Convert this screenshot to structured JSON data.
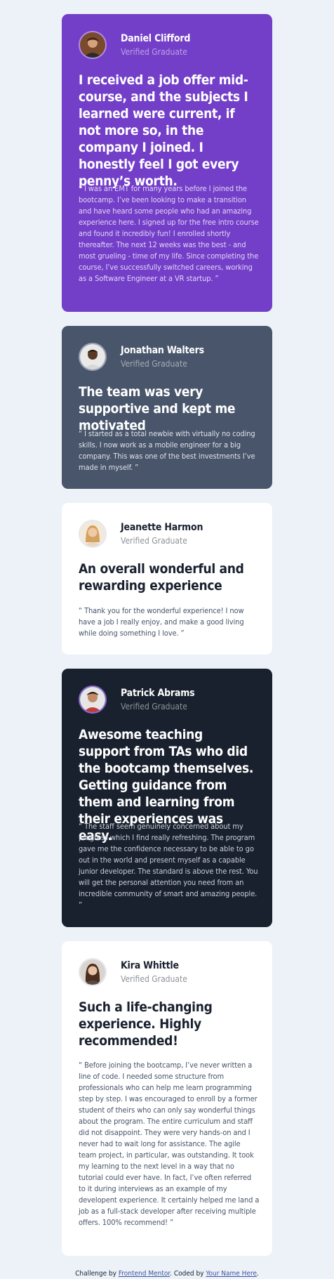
{
  "cards": [
    {
      "name": "Daniel Clifford",
      "role": "Verified Graduate",
      "headline": "I received a job offer mid-course, and the subjects I learned were current, if not more so, in the company I joined. I honestly feel I got every penny’s worth.",
      "quote": "“ I was an EMT for many years before I joined the bootcamp. I’ve been looking to make a transition and have heard some people who had an amazing experience here. I signed up for the free intro course and found it incredibly fun! I enrolled shortly thereafter. The next 12 weeks was the best - and most grueling - time of my life. Since completing the course, I’ve successfully switched careers, working as a Software Engineer at a VR startup. ”",
      "color": "#733fc8"
    },
    {
      "name": "Jonathan Walters",
      "role": "Verified Graduate",
      "headline": "The team was very supportive and kept me motivated",
      "quote": "“ I started as a total newbie with virtually no coding skills. I now work as a mobile engineer for a big company. This was one of the best investments I’ve made in myself. ”",
      "color": "#48556a"
    },
    {
      "name": "Jeanette Harmon",
      "role": "Verified Graduate",
      "headline": "An overall wonderful and rewarding experience",
      "quote": "“ Thank you for the wonderful experience! I now have a job I really enjoy, and make a good living while doing something I love. ”",
      "color": "#ffffff"
    },
    {
      "name": "Patrick Abrams",
      "role": "Verified Graduate",
      "headline": "Awesome teaching support from TAs who did the bootcamp themselves. Getting guidance from them and learning from their experiences was easy.",
      "quote": "“ The staff seem genuinely concerned about my progress which I find really refreshing. The program gave me the confidence necessary to be able to go out in the world and present myself as a capable junior developer. The standard is above the rest. You will get the personal attention you need from an incredible community of smart and amazing people. ”",
      "color": "#19212e"
    },
    {
      "name": "Kira Whittle",
      "role": "Verified Graduate",
      "headline": "Such a life-changing experience. Highly recommended!",
      "quote": "“ Before joining the bootcamp, I’ve never written a line of code. I needed some structure from professionals who can help me learn programming step by step. I was encouraged to enroll by a former student of theirs who can only say wonderful things about the program. The entire curriculum and staff did not disappoint. They were very hands-on and I never had to wait long for assistance. The agile team project, in particular, was outstanding. It took my learning to the next level in a way that no tutorial could ever have. In fact, I’ve often referred to it during interviews as an example of my developent experience. It certainly helped me land a job as a full-stack developer after receiving multiple offers. 100% recommend! ”",
      "color": "#ffffff"
    }
  ],
  "footer": {
    "prefix": "Challenge by ",
    "link1": "Frontend Mentor",
    "middle": ". Coded by ",
    "link2": "Your Name Here",
    "suffix": "."
  }
}
